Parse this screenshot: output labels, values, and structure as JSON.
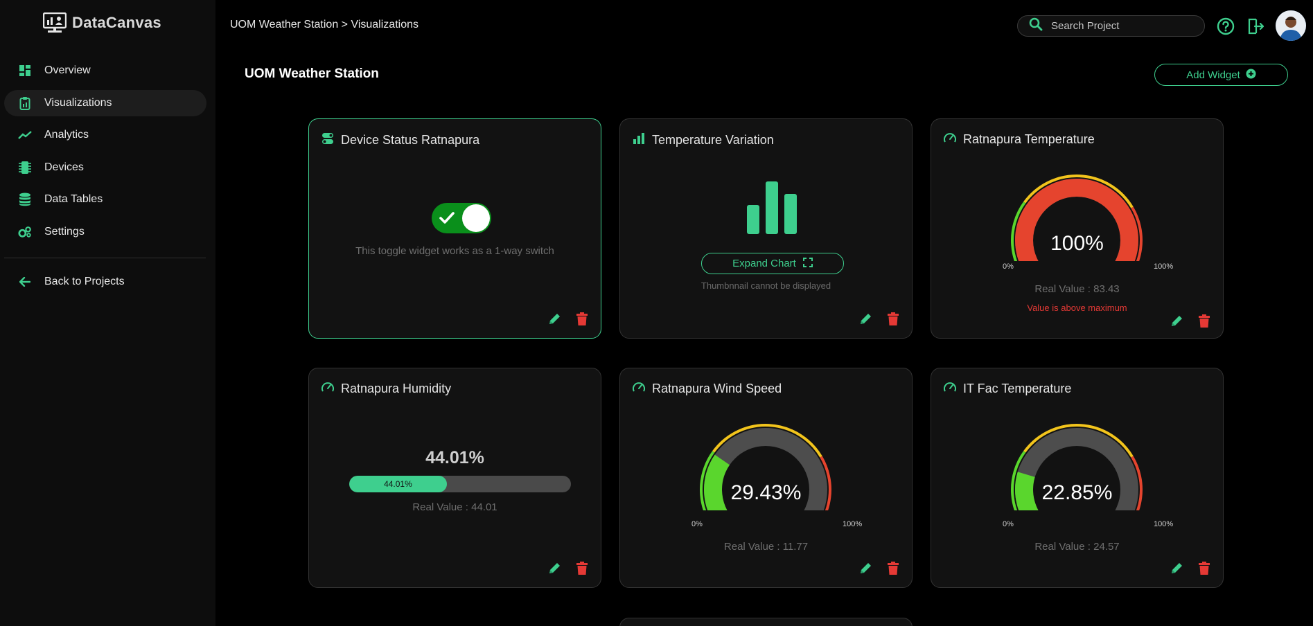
{
  "app": {
    "name": "DataCanvas"
  },
  "sidebar": {
    "items": [
      {
        "label": "Overview",
        "icon": "dashboard-icon",
        "active": false
      },
      {
        "label": "Visualizations",
        "icon": "clipboard-icon",
        "active": true
      },
      {
        "label": "Analytics",
        "icon": "trend-line-icon",
        "active": false
      },
      {
        "label": "Devices",
        "icon": "chip-icon",
        "active": false
      },
      {
        "label": "Data Tables",
        "icon": "database-icon",
        "active": false
      },
      {
        "label": "Settings",
        "icon": "gears-icon",
        "active": false
      }
    ],
    "back_label": "Back to Projects"
  },
  "header": {
    "breadcrumb": "UOM Weather Station > Visualizations",
    "search_placeholder": "Search Project"
  },
  "page": {
    "title": "UOM Weather Station",
    "add_widget_label": "Add Widget"
  },
  "colors": {
    "accent": "#3ecf8e",
    "danger": "#e53935",
    "toggle_on": "#0a8f1b"
  },
  "widgets": [
    {
      "title": "Device Status Ratnapura",
      "type": "toggle",
      "state": "on",
      "note": "This toggle widget works as a 1-way switch"
    },
    {
      "title": "Temperature Variation",
      "type": "chart",
      "button": "Expand Chart",
      "note": "Thumbnnail cannot be displayed"
    },
    {
      "title": "Ratnapura Temperature",
      "type": "gauge",
      "value": "100%",
      "min": "0%",
      "max": "100%",
      "real": "Real Value : 83.43",
      "warning": "Value is above maximum",
      "fraction": 1.0
    },
    {
      "title": "Ratnapura Humidity",
      "type": "progress",
      "value": "44.01%",
      "bar_label": "44.01%",
      "real": "Real Value : 44.01",
      "fraction": 0.4401
    },
    {
      "title": "Ratnapura Wind Speed",
      "type": "gauge",
      "value": "29.43%",
      "min": "0%",
      "max": "100%",
      "real": "Real Value : 11.77",
      "fraction": 0.2943
    },
    {
      "title": "IT Fac Temperature",
      "type": "gauge",
      "value": "22.85%",
      "min": "0%",
      "max": "100%",
      "real": "Real Value : 24.57",
      "fraction": 0.2285
    }
  ]
}
